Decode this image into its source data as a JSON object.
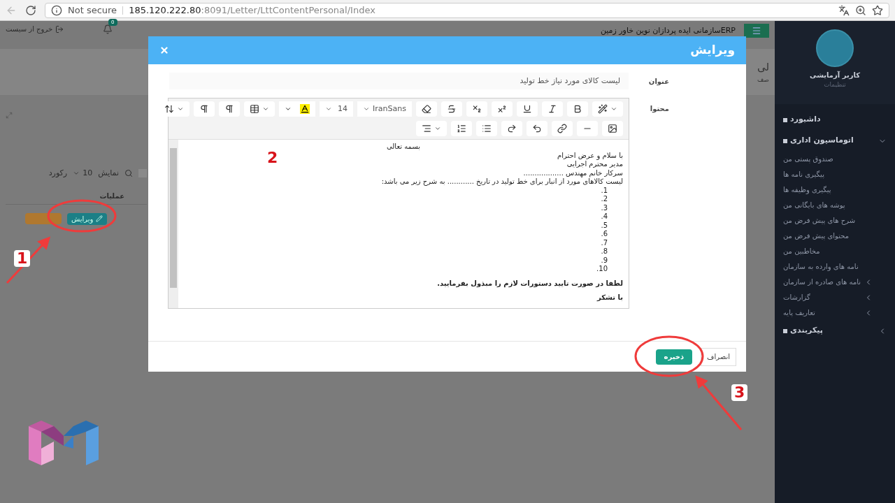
{
  "browser": {
    "security": "Not secure",
    "url_host": "185.120.222.80",
    "url_path": ":8091/Letter/LttContentPersonal/Index"
  },
  "topbar": {
    "logout": "خروج از سیست",
    "notifications": "0",
    "title": "ERPسازمانی ایده پردازان نوین خاور زمین"
  },
  "page": {
    "heading": "لی",
    "subheading": "صف",
    "show_label": "نمایش",
    "page_size": "10",
    "records_label": "رکورد",
    "column_header": "عملیات",
    "edit_button": "ویرایش"
  },
  "sidebar": {
    "user": "کاربر آزمایشی",
    "settings": "تنظیمات",
    "menu": [
      {
        "label": "داشبورد",
        "kind": "link"
      },
      {
        "label": "اتوماسیون اداری",
        "kind": "group",
        "expanded": true,
        "children": [
          {
            "label": "صندوق پستی من",
            "kind": "link"
          },
          {
            "label": "پیگیری نامه ها",
            "kind": "link"
          },
          {
            "label": "پیگیری وظیفه ها",
            "kind": "link"
          },
          {
            "label": "پوشه های بایگانی من",
            "kind": "link"
          },
          {
            "label": "شرح های پیش فرض من",
            "kind": "link"
          },
          {
            "label": "محتوای پیش فرض من",
            "kind": "link"
          },
          {
            "label": "مخاطبین من",
            "kind": "link"
          },
          {
            "label": "نامه های وارده به سازمان",
            "kind": "link"
          },
          {
            "label": "نامه های صادره از سازمان",
            "kind": "group",
            "expanded": false
          },
          {
            "label": "گزارشات",
            "kind": "group",
            "expanded": false
          },
          {
            "label": "تعاریف پایه",
            "kind": "group",
            "expanded": false
          }
        ]
      },
      {
        "label": "پیکربندی",
        "kind": "group",
        "expanded": false
      }
    ]
  },
  "modal": {
    "title": "ویرایش",
    "subject_label": "عنوان",
    "subject_value": "لیست کالای مورد نیاز خط تولید",
    "content_label": "محتوا",
    "editor": {
      "font": "IranSans",
      "size": "14",
      "lines": [
        {
          "text": "بسمه تعالی",
          "kind": "center"
        },
        {
          "text": "با سلام و عرض احترام",
          "kind": "line"
        },
        {
          "text": "مدیر محترم اجرایی",
          "kind": "line"
        },
        {
          "text": "سرکار خانم مهندس ..................",
          "kind": "line"
        },
        {
          "text": "لیست کالاهای مورد از انبار برای خط تولید در تاریخ ............ به شرح زیر می باشد:",
          "kind": "line"
        },
        {
          "text": "1.",
          "kind": "item"
        },
        {
          "text": "2.",
          "kind": "item"
        },
        {
          "text": "3.",
          "kind": "item"
        },
        {
          "text": "4.",
          "kind": "item"
        },
        {
          "text": "5.",
          "kind": "item"
        },
        {
          "text": "6.",
          "kind": "item"
        },
        {
          "text": "7.",
          "kind": "item"
        },
        {
          "text": "8.",
          "kind": "item"
        },
        {
          "text": "9.",
          "kind": "item"
        },
        {
          "text": "10.",
          "kind": "item"
        },
        {
          "text": "لطفا در صورت تایید دستورات لازم را مبذول بفرمایید.",
          "kind": "para"
        },
        {
          "text": "با تشکر",
          "kind": "para"
        }
      ]
    },
    "save": "ذخیره",
    "cancel": "انصراف"
  },
  "annotations": [
    {
      "label": "1"
    },
    {
      "label": "2"
    },
    {
      "label": "3"
    }
  ]
}
